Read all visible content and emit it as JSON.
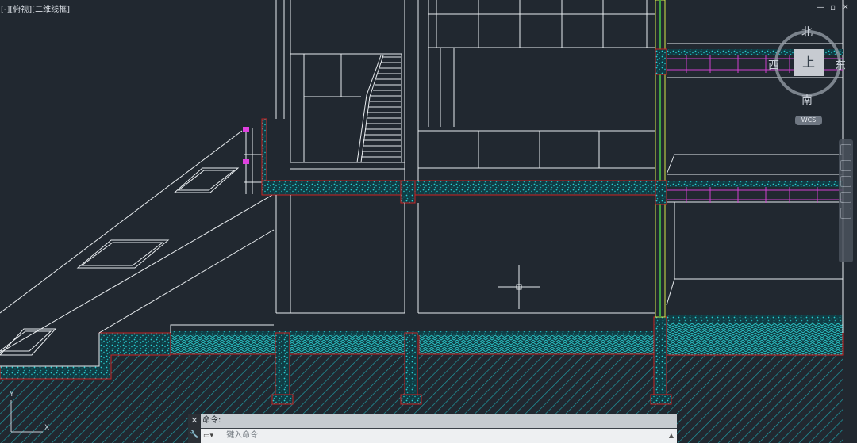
{
  "viewport": {
    "label": "[-][俯视][二维线框]",
    "controls": {
      "minimize": "—",
      "restore": "▫",
      "close": "✕"
    }
  },
  "viewcube": {
    "north": "北",
    "south": "南",
    "east": "东",
    "west": "西",
    "top": "上",
    "wcs": "WCS"
  },
  "ucs": {
    "x_label": "X",
    "y_label": "Y"
  },
  "command": {
    "history": "命令:",
    "placeholder": "键入命令",
    "close_glyph": "✕",
    "settings_glyph": "🔧"
  },
  "colors": {
    "background": "#212830",
    "line": "#e8ecef",
    "hatch": "#1fa0a6",
    "section": "#d02a2a",
    "highlight": "#e040e0",
    "glass": "#d4e84a"
  }
}
